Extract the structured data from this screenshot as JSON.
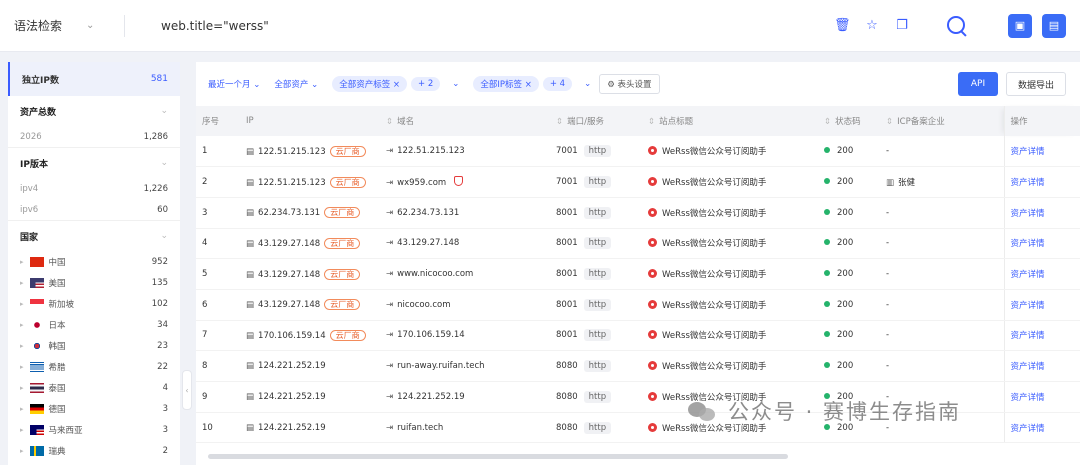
{
  "search": {
    "syntax_label": "语法检索",
    "query": "web.title=\"werss\""
  },
  "sidebar": {
    "unique_ip": {
      "label": "独立IP数",
      "count": "581"
    },
    "sections": [
      {
        "title": "资产总数",
        "rows": [
          {
            "label": "2026",
            "count": "1,286"
          }
        ]
      },
      {
        "title": "IP版本",
        "rows": [
          {
            "label": "ipv4",
            "count": "1,226"
          },
          {
            "label": "ipv6",
            "count": "60"
          }
        ]
      }
    ],
    "country": {
      "title": "国家",
      "items": [
        {
          "name": "中国",
          "count": "952"
        },
        {
          "name": "美国",
          "count": "135"
        },
        {
          "name": "新加坡",
          "count": "102"
        },
        {
          "name": "日本",
          "count": "34"
        },
        {
          "name": "韩国",
          "count": "23"
        },
        {
          "name": "希腊",
          "count": "22"
        },
        {
          "name": "泰国",
          "count": "4"
        },
        {
          "name": "德国",
          "count": "3"
        },
        {
          "name": "马来西亚",
          "count": "3"
        },
        {
          "name": "瑞典",
          "count": "2"
        }
      ]
    }
  },
  "toolbar": {
    "time_filter": "最近一个月",
    "asset_filter": "全部资产",
    "asset_tag": "全部资产标签",
    "asset_tag_more": "+ 2",
    "ip_tag": "全部IP标签",
    "ip_tag_more": "+ 4",
    "column_settings": "表头设置",
    "api_label": "API",
    "export_label": "数据导出"
  },
  "table": {
    "columns": [
      "序号",
      "IP",
      "域名",
      "端口/服务",
      "站点标题",
      "状态码",
      "ICP备案企业",
      "操作"
    ],
    "cloud_tag": "云厂商",
    "detail_link": "资产详情",
    "rows": [
      {
        "no": "1",
        "ip": "122.51.215.123",
        "cloud": true,
        "domain": "122.51.215.123",
        "shield": false,
        "port": "7001",
        "service": "http",
        "title": "WeRss微信公众号订阅助手",
        "status": "200",
        "icp": "-"
      },
      {
        "no": "2",
        "ip": "122.51.215.123",
        "cloud": true,
        "domain": "wx959.com",
        "shield": true,
        "port": "7001",
        "service": "http",
        "title": "WeRss微信公众号订阅助手",
        "status": "200",
        "icp": "张健"
      },
      {
        "no": "3",
        "ip": "62.234.73.131",
        "cloud": true,
        "domain": "62.234.73.131",
        "shield": false,
        "port": "8001",
        "service": "http",
        "title": "WeRss微信公众号订阅助手",
        "status": "200",
        "icp": "-"
      },
      {
        "no": "4",
        "ip": "43.129.27.148",
        "cloud": true,
        "domain": "43.129.27.148",
        "shield": false,
        "port": "8001",
        "service": "http",
        "title": "WeRss微信公众号订阅助手",
        "status": "200",
        "icp": "-"
      },
      {
        "no": "5",
        "ip": "43.129.27.148",
        "cloud": true,
        "domain": "www.nicocoo.com",
        "shield": false,
        "port": "8001",
        "service": "http",
        "title": "WeRss微信公众号订阅助手",
        "status": "200",
        "icp": "-"
      },
      {
        "no": "6",
        "ip": "43.129.27.148",
        "cloud": true,
        "domain": "nicocoo.com",
        "shield": false,
        "port": "8001",
        "service": "http",
        "title": "WeRss微信公众号订阅助手",
        "status": "200",
        "icp": "-"
      },
      {
        "no": "7",
        "ip": "170.106.159.14",
        "cloud": true,
        "domain": "170.106.159.14",
        "shield": false,
        "port": "8001",
        "service": "http",
        "title": "WeRss微信公众号订阅助手",
        "status": "200",
        "icp": "-"
      },
      {
        "no": "8",
        "ip": "124.221.252.19",
        "cloud": false,
        "domain": "run-away.ruifan.tech",
        "shield": false,
        "port": "8080",
        "service": "http",
        "title": "WeRss微信公众号订阅助手",
        "status": "200",
        "icp": "-"
      },
      {
        "no": "9",
        "ip": "124.221.252.19",
        "cloud": false,
        "domain": "124.221.252.19",
        "shield": false,
        "port": "8080",
        "service": "http",
        "title": "WeRss微信公众号订阅助手",
        "status": "200",
        "icp": "-"
      },
      {
        "no": "10",
        "ip": "124.221.252.19",
        "cloud": false,
        "domain": "ruifan.tech",
        "shield": false,
        "port": "8080",
        "service": "http",
        "title": "WeRss微信公众号订阅助手",
        "status": "200",
        "icp": "-"
      }
    ]
  },
  "watermark": "公众号 · 赛博生存指南"
}
